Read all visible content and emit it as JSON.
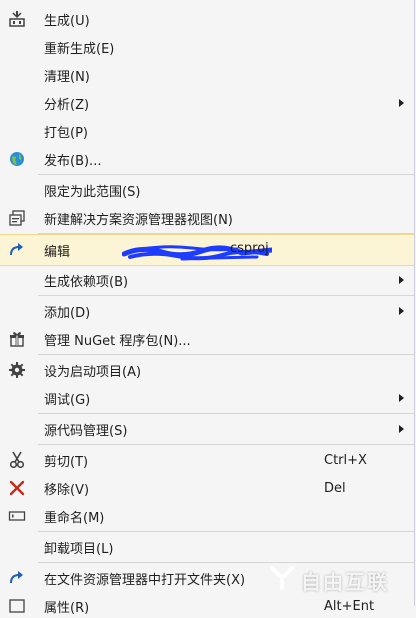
{
  "menu": {
    "items": [
      {
        "label": "生成(U)",
        "icon": "build-icon"
      },
      {
        "label": "重新生成(E)"
      },
      {
        "label": "清理(N)"
      },
      {
        "label": "分析(Z)"
      },
      {
        "label": "打包(P)"
      },
      {
        "label": "发布(B)...",
        "icon": "globe-icon"
      },
      {
        "label": "限定为此范围(S)"
      },
      {
        "label": "新建解决方案资源管理器视图(N)",
        "icon": "new-view-icon"
      },
      {
        "label": "编辑",
        "suffix": "csproj",
        "icon": "redo-arrow-icon"
      },
      {
        "label": "生成依赖项(B)"
      },
      {
        "label": "添加(D)"
      },
      {
        "label": "管理 NuGet 程序包(N)...",
        "icon": "nuget-package-icon"
      },
      {
        "label": "设为启动项目(A)",
        "icon": "gear-icon"
      },
      {
        "label": "调试(G)"
      },
      {
        "label": "源代码管理(S)"
      },
      {
        "label": "剪切(T)",
        "shortcut": "Ctrl+X",
        "icon": "scissors-icon"
      },
      {
        "label": "移除(V)",
        "shortcut": "Del",
        "icon": "remove-x-icon"
      },
      {
        "label": "重命名(M)",
        "icon": "rename-icon"
      },
      {
        "label": "卸载项目(L)"
      },
      {
        "label": "在文件资源管理器中打开文件夹(X)",
        "icon": "open-folder-arrow-icon"
      },
      {
        "label": "属性(R)",
        "shortcut": "Alt+Ent"
      }
    ],
    "highlight_color": "#fcf5d5",
    "accent_blue": "#1e5fb4"
  },
  "watermark": {
    "text": "自由互联"
  }
}
